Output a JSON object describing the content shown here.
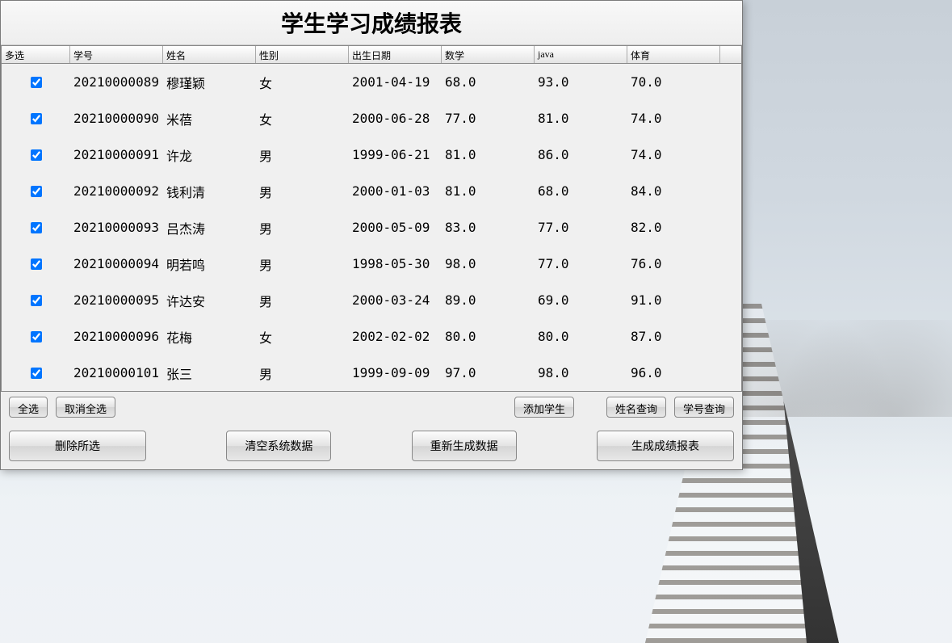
{
  "title": "学生学习成绩报表",
  "columns": {
    "check": "多选",
    "id": "学号",
    "name": "姓名",
    "gender": "性别",
    "dob": "出生日期",
    "math": "数学",
    "java": "java",
    "pe": "体育"
  },
  "rows": [
    {
      "checked": true,
      "id": "20210000089",
      "name": "穆瑾颖",
      "gender": "女",
      "dob": "2001-04-19",
      "math": "68.0",
      "java": "93.0",
      "pe": "70.0"
    },
    {
      "checked": true,
      "id": "20210000090",
      "name": "米蓓",
      "gender": "女",
      "dob": "2000-06-28",
      "math": "77.0",
      "java": "81.0",
      "pe": "74.0"
    },
    {
      "checked": true,
      "id": "20210000091",
      "name": "许龙",
      "gender": "男",
      "dob": "1999-06-21",
      "math": "81.0",
      "java": "86.0",
      "pe": "74.0"
    },
    {
      "checked": true,
      "id": "20210000092",
      "name": "钱利清",
      "gender": "男",
      "dob": "2000-01-03",
      "math": "81.0",
      "java": "68.0",
      "pe": "84.0"
    },
    {
      "checked": true,
      "id": "20210000093",
      "name": "吕杰涛",
      "gender": "男",
      "dob": "2000-05-09",
      "math": "83.0",
      "java": "77.0",
      "pe": "82.0"
    },
    {
      "checked": true,
      "id": "20210000094",
      "name": "明若鸣",
      "gender": "男",
      "dob": "1998-05-30",
      "math": "98.0",
      "java": "77.0",
      "pe": "76.0"
    },
    {
      "checked": true,
      "id": "20210000095",
      "name": "许达安",
      "gender": "男",
      "dob": "2000-03-24",
      "math": "89.0",
      "java": "69.0",
      "pe": "91.0"
    },
    {
      "checked": true,
      "id": "20210000096",
      "name": "花梅",
      "gender": "女",
      "dob": "2002-02-02",
      "math": "80.0",
      "java": "80.0",
      "pe": "87.0"
    },
    {
      "checked": true,
      "id": "20210000101",
      "name": "张三",
      "gender": "男",
      "dob": "1999-09-09",
      "math": "97.0",
      "java": "98.0",
      "pe": "96.0"
    }
  ],
  "buttons": {
    "selectAll": "全选",
    "deselectAll": "取消全选",
    "addStudent": "添加学生",
    "searchByName": "姓名查询",
    "searchById": "学号查询",
    "deleteSelected": "删除所选",
    "clearSystemData": "清空系统数据",
    "regenerateData": "重新生成数据",
    "generateReport": "生成成绩报表"
  }
}
